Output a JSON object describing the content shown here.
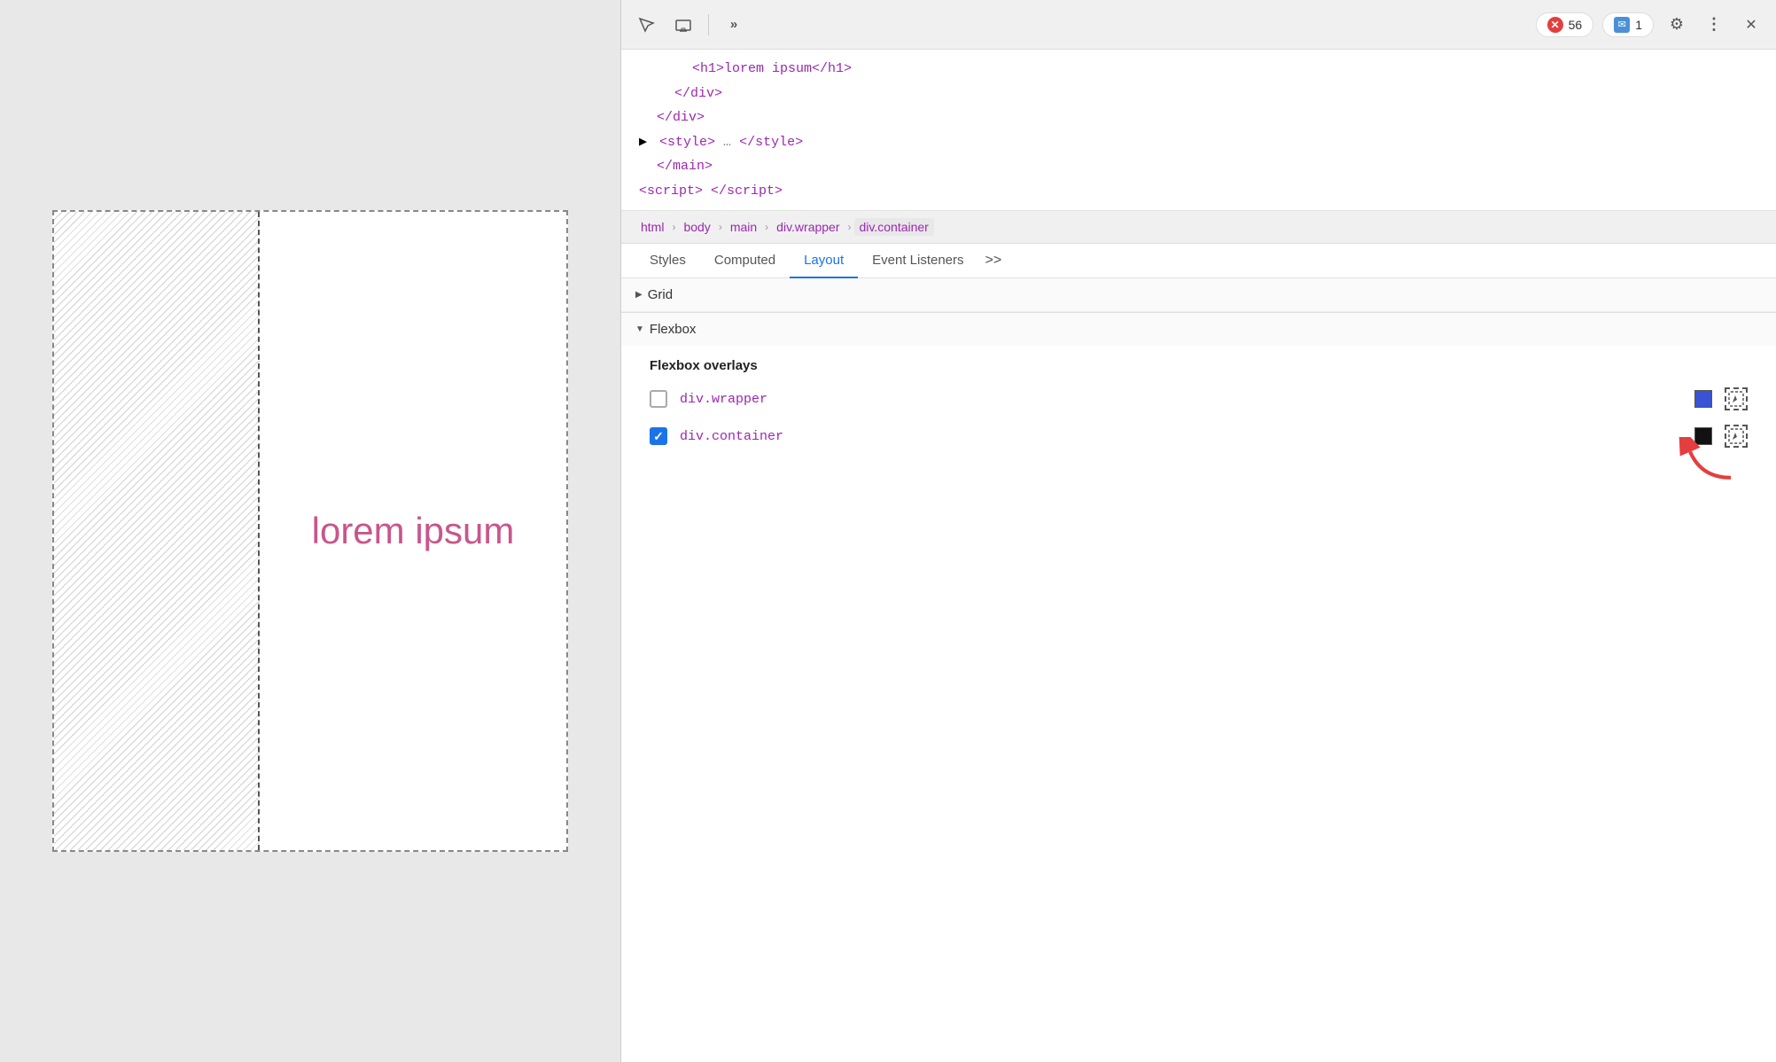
{
  "viewport": {
    "lorem_text": "lorem ipsum"
  },
  "devtools": {
    "toolbar": {
      "inspect_icon": "⊹",
      "device_icon": "▭",
      "more_icon": "»",
      "error_count": "56",
      "message_count": "1",
      "settings_icon": "⚙",
      "menu_icon": "⋮",
      "close_icon": "✕"
    },
    "html_tree": {
      "lines": [
        {
          "indent": 1,
          "html": "<span class='tag-purple'>&lt;h1&gt;lorem ipsum&lt;/h1&gt;</span>",
          "selected": false
        },
        {
          "indent": 0,
          "html": "<span class='tag-purple'>&nbsp;&nbsp;&nbsp;&nbsp;&lt;/div&gt;</span>",
          "selected": false
        },
        {
          "indent": 0,
          "html": "<span class='tag-purple'>&nbsp;&nbsp;&lt;/div&gt;</span>",
          "selected": false
        },
        {
          "indent": 0,
          "html": "<span class='tree-triangle'>▶</span><span class='tag-purple'>&lt;style&gt;</span><span style='color:#777'>…</span><span class='tag-purple'>&lt;/style&gt;</span>",
          "selected": false
        },
        {
          "indent": 0,
          "html": "<span class='tag-purple'>&nbsp;&nbsp;&lt;/main&gt;</span>",
          "selected": false
        },
        {
          "indent": 0,
          "html": "<span class='tag-purple'>&nbsp;&nbsp;&lt;script&gt; &lt;/script&gt;</span>",
          "selected": false
        }
      ]
    },
    "breadcrumb": {
      "items": [
        "html",
        "body",
        "main",
        "div.wrapper",
        "div.container"
      ]
    },
    "tabs": {
      "items": [
        "Styles",
        "Computed",
        "Layout",
        "Event Listeners"
      ],
      "active": "Layout",
      "more": ">>"
    },
    "grid_section": {
      "label": "Grid",
      "collapsed": true
    },
    "flexbox_section": {
      "label": "Flexbox",
      "overlays_title": "Flexbox overlays",
      "items": [
        {
          "checked": false,
          "label": "div.wrapper",
          "color": "#3a52d4",
          "has_highlight": true
        },
        {
          "checked": true,
          "label": "div.container",
          "color": "#111111",
          "has_highlight": true
        }
      ]
    }
  }
}
